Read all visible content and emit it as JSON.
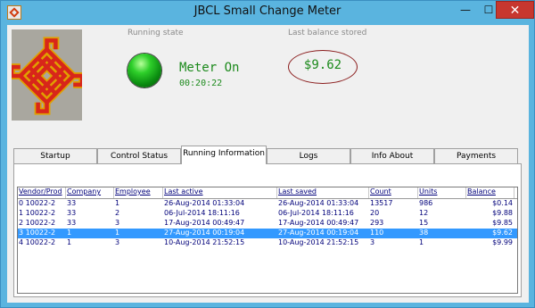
{
  "window": {
    "title": "JBCL Small Change Meter",
    "min_glyph": "—",
    "max_glyph": "☐",
    "close_glyph": "✕"
  },
  "status": {
    "running_state_caption": "Running state",
    "last_balance_caption": "Last balance stored",
    "meter_state": "Meter On",
    "elapsed": "00:20:22",
    "balance": "$9.62",
    "led_color": "#2ecf2a"
  },
  "tabs": [
    {
      "label": "Startup",
      "active": false
    },
    {
      "label": "Control Status",
      "active": false
    },
    {
      "label": "Running Information",
      "active": true
    },
    {
      "label": "Logs",
      "active": false
    },
    {
      "label": "Info About",
      "active": false
    },
    {
      "label": "Payments",
      "active": false
    }
  ],
  "table": {
    "columns": [
      "Vendor/Prod",
      "Company",
      "Employee",
      "Last active",
      "Last saved",
      "Count",
      "Units",
      "Balance"
    ],
    "rows": [
      [
        "0 10022-2",
        "33",
        "1",
        "26-Aug-2014 01:33:04",
        "26-Aug-2014 01:33:04",
        "13517",
        "986",
        "$0.14"
      ],
      [
        "1 10022-2",
        "33",
        "2",
        "06-Jul-2014 18:11:16",
        "06-Jul-2014 18:11:16",
        "20",
        "12",
        "$9.88"
      ],
      [
        "2 10022-2",
        "33",
        "3",
        "17-Aug-2014 00:49:47",
        "17-Aug-2014 00:49:47",
        "293",
        "15",
        "$9.85"
      ],
      [
        "3 10022-2",
        "1",
        "1",
        "27-Aug-2014 00:19:04",
        "27-Aug-2014 00:19:04",
        "110",
        "38",
        "$9.62"
      ],
      [
        "4 10022-2",
        "1",
        "3",
        "10-Aug-2014 21:52:15",
        "10-Aug-2014 21:52:15",
        "3",
        "1",
        "$9.99"
      ]
    ],
    "selected_row": 3
  }
}
